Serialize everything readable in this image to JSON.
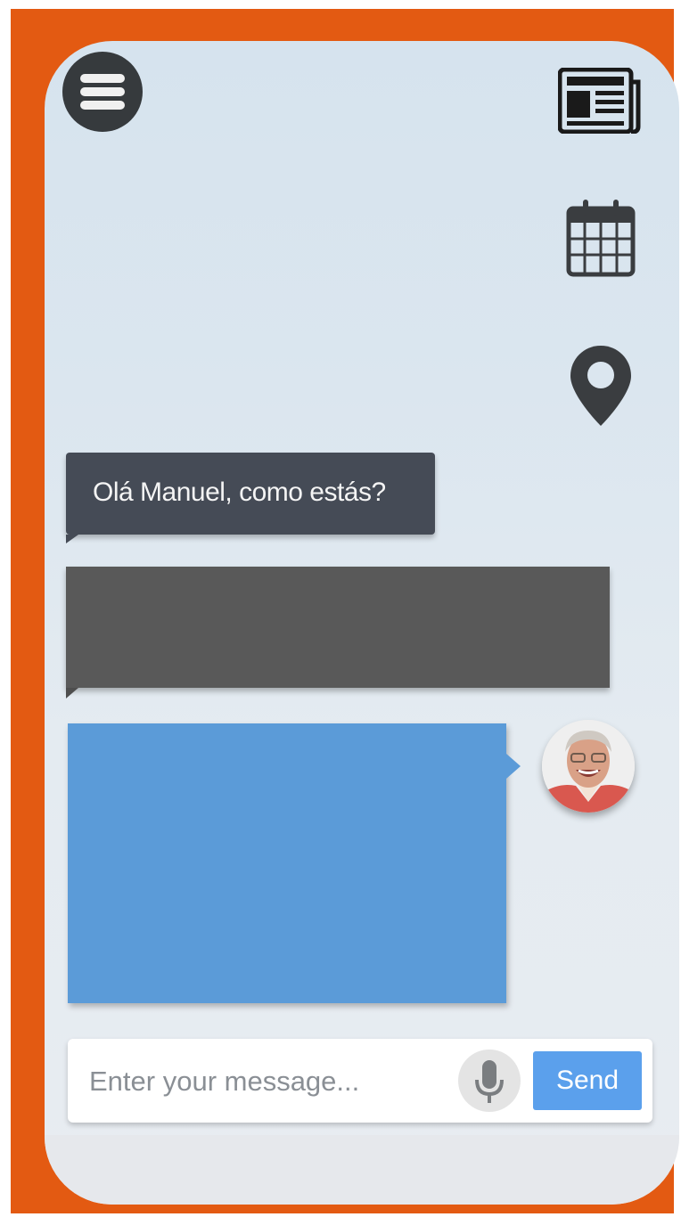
{
  "header": {
    "menu_icon": "hamburger-menu-icon",
    "side_icons": [
      "newspaper-icon",
      "calendar-icon",
      "location-pin-icon"
    ]
  },
  "chat": {
    "incoming_message": "Olá Manuel, como estás?",
    "redacted_dark_message": "",
    "redacted_blue_message": "",
    "avatar": "user-avatar"
  },
  "composer": {
    "placeholder": "Enter your message...",
    "mic_icon": "microphone-icon",
    "send_label": "Send"
  },
  "colors": {
    "frame": "#e35a12",
    "incoming_bubble": "#454b56",
    "dark_bubble": "#595959",
    "outgoing_bubble": "#5b9bd8",
    "send_button": "#5ba0ec",
    "menu_button": "#363a3d"
  }
}
